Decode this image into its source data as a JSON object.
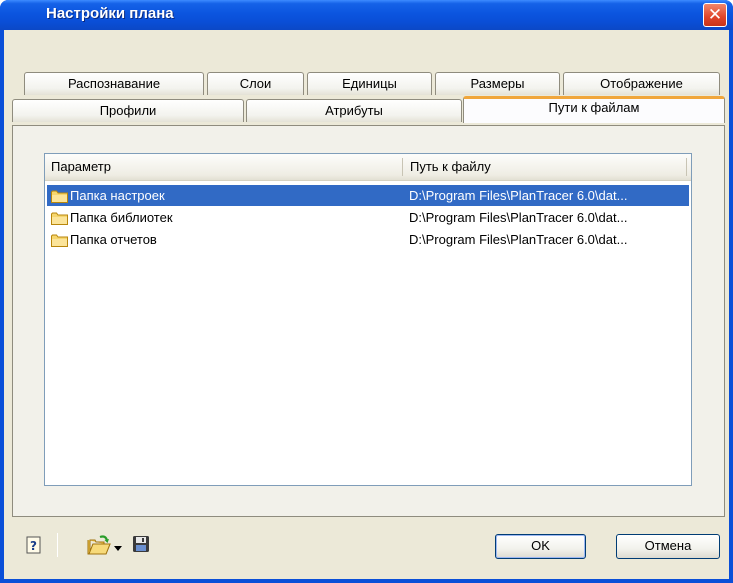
{
  "window": {
    "title": "Настройки плана",
    "close_label": "✕"
  },
  "tabs": {
    "row_back": [
      {
        "label": "Распознавание"
      },
      {
        "label": "Слои"
      },
      {
        "label": "Единицы"
      },
      {
        "label": "Размеры"
      },
      {
        "label": "Отображение"
      }
    ],
    "row_front": [
      {
        "label": "Профили"
      },
      {
        "label": "Атрибуты"
      },
      {
        "label": "Пути к файлам",
        "active": true
      }
    ]
  },
  "list": {
    "columns": [
      "Параметр",
      "Путь к файлу"
    ],
    "rows": [
      {
        "name": "Папка настроек",
        "path": "D:\\Program Files\\PlanTracer 6.0\\dat...",
        "selected": true
      },
      {
        "name": "Папка библиотек",
        "path": "D:\\Program Files\\PlanTracer 6.0\\dat..."
      },
      {
        "name": "Папка отчетов",
        "path": "D:\\Program Files\\PlanTracer 6.0\\dat..."
      }
    ]
  },
  "footer": {
    "help_icon": "help-icon",
    "open_icon": "open-folder-icon",
    "save_icon": "save-icon",
    "ok_label": "OK",
    "cancel_label": "Отмена"
  },
  "colors": {
    "title_blue": "#0a4fd8",
    "selection": "#316ac5",
    "active_tab_accent": "#f0a63b",
    "dialog_bg": "#ece9d8"
  }
}
